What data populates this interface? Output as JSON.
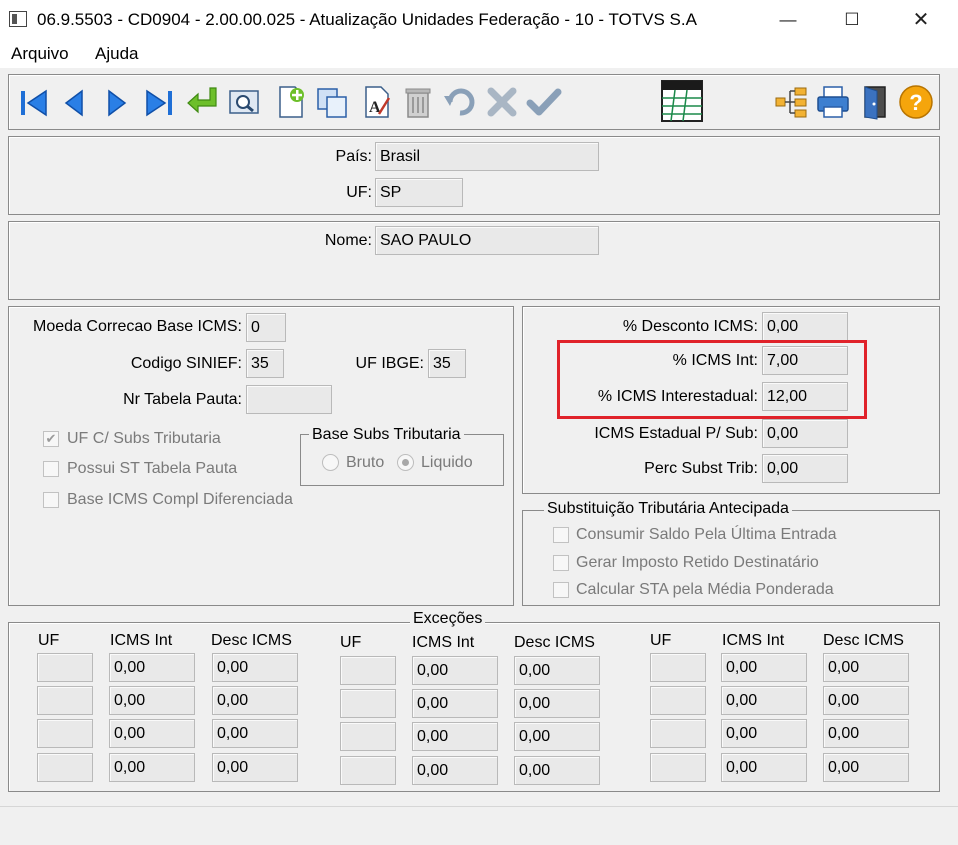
{
  "window": {
    "title": "06.9.5503 - CD0904 - 2.00.00.025 - Atualização Unidades Federação - 10 - TOTVS S.A",
    "minimize_glyph": "—",
    "maximize_glyph": "☐",
    "close_glyph": "✕"
  },
  "menu": {
    "items": [
      "Arquivo",
      "Ajuda"
    ]
  },
  "toolbar": {
    "icons": [
      "first-record-icon",
      "previous-record-icon",
      "next-record-icon",
      "last-record-icon",
      "goto-icon",
      "search-icon",
      "new-record-icon",
      "copy-record-icon",
      "edit-record-icon",
      "delete-record-icon",
      "undo-icon",
      "cancel-icon",
      "confirm-icon",
      "spreadsheet-icon",
      "tree-icon",
      "print-icon",
      "exit-icon",
      "help-icon"
    ],
    "help_glyph": "?"
  },
  "header": {
    "pais_label": "País:",
    "pais_value": "Brasil",
    "uf_label": "UF:",
    "uf_value": "SP",
    "nome_label": "Nome:",
    "nome_value": "SAO PAULO"
  },
  "left": {
    "moeda_label": "Moeda Correcao Base ICMS:",
    "moeda_value": "0",
    "sinief_label": "Codigo SINIEF:",
    "sinief_value": "35",
    "ibge_label": "UF IBGE:",
    "ibge_value": "35",
    "pauta_label": "Nr Tabela Pauta:",
    "pauta_value": "",
    "checks": [
      {
        "label": "UF C/ Subs Tributaria",
        "checked": true
      },
      {
        "label": "Possui ST Tabela Pauta",
        "checked": false
      },
      {
        "label": "Base ICMS Compl Diferenciada",
        "checked": false
      }
    ],
    "base_subs": {
      "title": "Base Subs Tributaria",
      "options": [
        "Bruto",
        "Liquido"
      ],
      "selected": "Liquido"
    }
  },
  "icms": {
    "rows": [
      {
        "label": "% Desconto ICMS:",
        "value": "0,00"
      },
      {
        "label": "% ICMS Int:",
        "value": "7,00"
      },
      {
        "label": "% ICMS Interestadual:",
        "value": "12,00"
      },
      {
        "label": "ICMS Estadual P/ Sub:",
        "value": "0,00"
      },
      {
        "label": "Perc Subst Trib:",
        "value": "0,00"
      }
    ]
  },
  "sta": {
    "title": "Substituição Tributária Antecipada",
    "checks": [
      {
        "label": "Consumir Saldo Pela Última Entrada",
        "checked": false
      },
      {
        "label": "Gerar Imposto Retido Destinatário",
        "checked": false
      },
      {
        "label": "Calcular STA pela Média Ponderada",
        "checked": false
      }
    ]
  },
  "excecoes": {
    "title": "Exceções",
    "headers": [
      "UF",
      "ICMS Int",
      "Desc ICMS"
    ],
    "groups": [
      {
        "rows": [
          [
            "",
            "0,00",
            "0,00"
          ],
          [
            "",
            "0,00",
            "0,00"
          ],
          [
            "",
            "0,00",
            "0,00"
          ],
          [
            "",
            "0,00",
            "0,00"
          ]
        ]
      },
      {
        "rows": [
          [
            "",
            "0,00",
            "0,00"
          ],
          [
            "",
            "0,00",
            "0,00"
          ],
          [
            "",
            "0,00",
            "0,00"
          ],
          [
            "",
            "0,00",
            "0,00"
          ]
        ]
      },
      {
        "rows": [
          [
            "",
            "0,00",
            "0,00"
          ],
          [
            "",
            "0,00",
            "0,00"
          ],
          [
            "",
            "0,00",
            "0,00"
          ],
          [
            "",
            "0,00",
            "0,00"
          ]
        ]
      }
    ]
  }
}
